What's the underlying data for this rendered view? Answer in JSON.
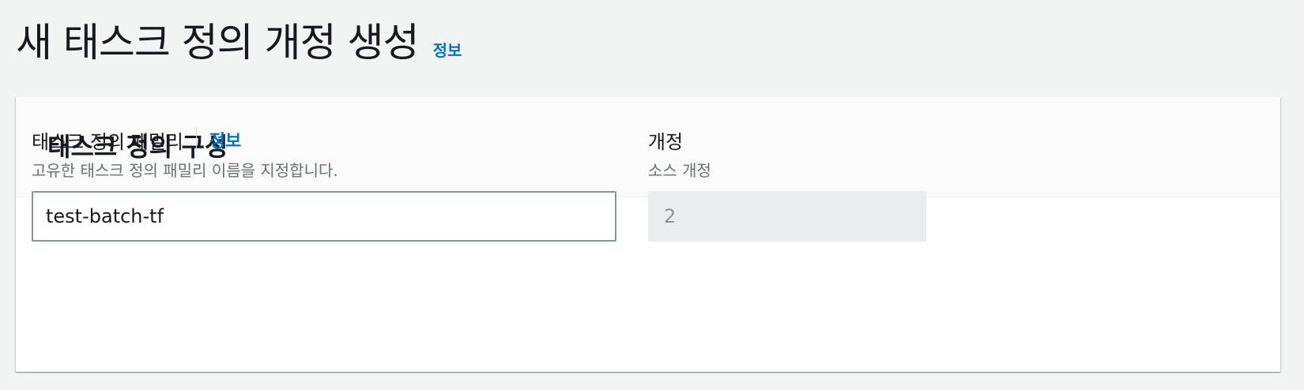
{
  "page": {
    "title": "새 태스크 정의 개정 생성",
    "info_link": "정보"
  },
  "panel": {
    "title": "태스크 정의 구성",
    "family_field": {
      "label": "태스크 정의 패밀리",
      "info_link": "정보",
      "description": "고유한 태스크 정의 패밀리 이름을 지정합니다.",
      "value": "test-batch-tf"
    },
    "revision_field": {
      "label": "개정",
      "description": "소스 개정",
      "value": "2"
    }
  },
  "colors": {
    "background": "#f2f3f3",
    "link": "#0073bb",
    "text": "#16191f",
    "muted_text": "#687078",
    "input_border": "#879596",
    "readonly_bg": "#eaeded"
  }
}
